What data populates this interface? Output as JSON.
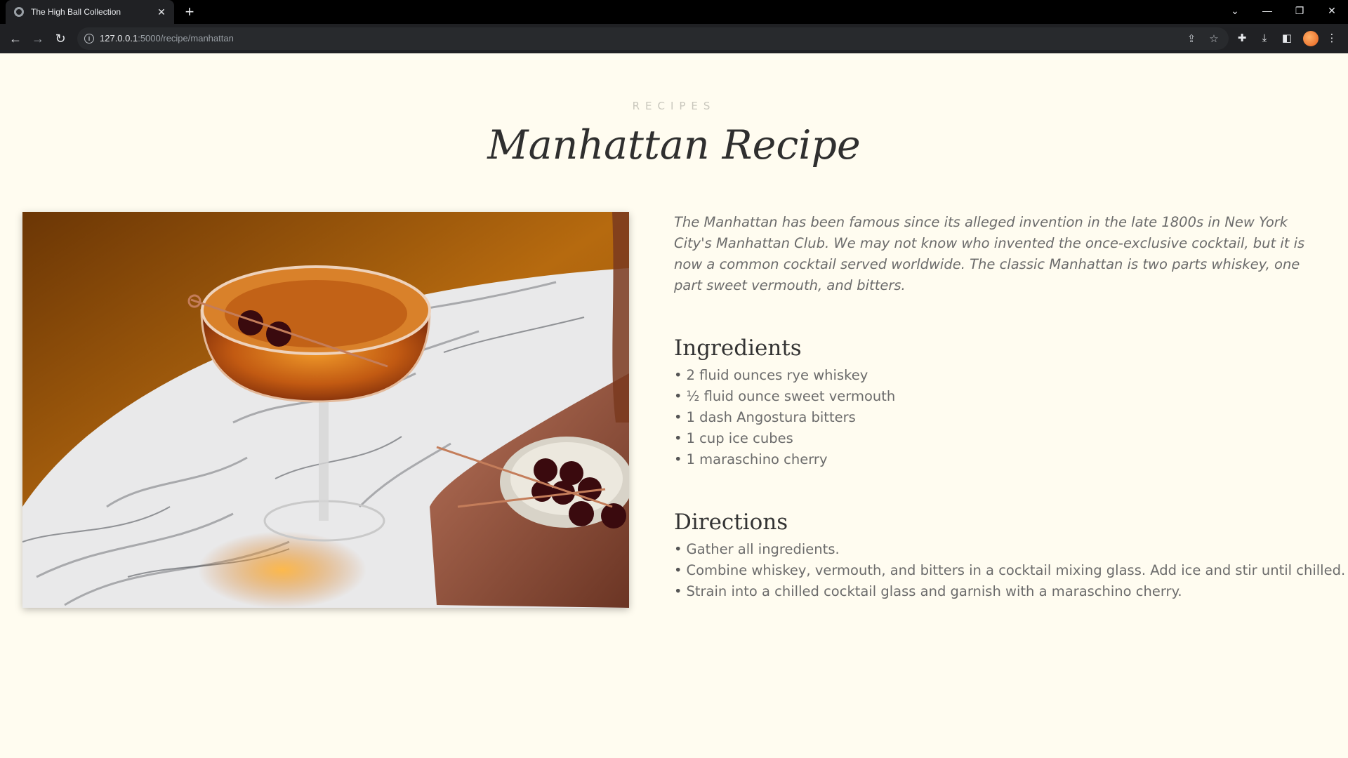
{
  "browser": {
    "tab_title": "The High Ball Collection",
    "url_host": "127.0.0.1",
    "url_path": ":5000/recipe/manhattan"
  },
  "page": {
    "eyebrow": "RECIPES",
    "title": "Manhattan Recipe",
    "intro": "The Manhattan has been famous since its alleged invention in the late 1800s in New York City's Manhattan Club. We may not know who invented the once-exclusive cocktail, but it is now a common cocktail served worldwide. The classic Manhattan is two parts whiskey, one part sweet vermouth, and bitters.",
    "ingredients_title": "Ingredients",
    "ingredients": [
      "2 fluid ounces rye whiskey",
      "½ fluid ounce sweet vermouth",
      "1 dash Angostura bitters",
      "1 cup ice cubes",
      "1 maraschino cherry"
    ],
    "directions_title": "Directions",
    "directions": [
      "Gather all ingredients.",
      "Combine whiskey, vermouth, and bitters in a cocktail mixing glass. Add ice and stir until chilled.",
      "Strain into a chilled cocktail glass and garnish with a maraschino cherry."
    ],
    "bullet": "•"
  },
  "colors": {
    "page_background": "#fffcf0",
    "title_text": "#2f2f2f",
    "body_text": "#6b6b6b",
    "eyebrow_text": "#c9c7bd"
  }
}
